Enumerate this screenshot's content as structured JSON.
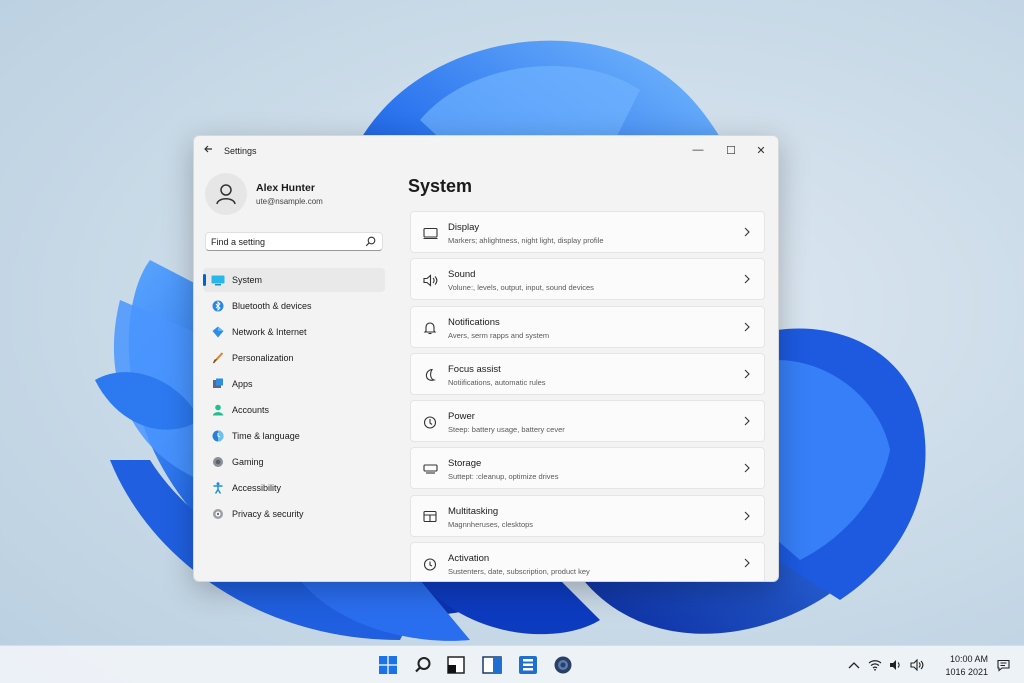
{
  "window": {
    "title": "Settings",
    "back_icon": "arrow-left-icon",
    "controls": {
      "minimize": "—",
      "maximize": "☐",
      "close": "✕"
    }
  },
  "profile": {
    "name": "Alex Hunter",
    "email": "ute@nsample.com",
    "avatar_icon": "user-icon"
  },
  "search": {
    "placeholder": "Find a setting",
    "value": "",
    "icon": "search-icon"
  },
  "sidebar": {
    "items": [
      {
        "label": "System",
        "icon": "system-icon",
        "active": true
      },
      {
        "label": "Bluetooth & devices",
        "icon": "bluetooth-icon"
      },
      {
        "label": "Network & Internet",
        "icon": "network-icon"
      },
      {
        "label": "Personalization",
        "icon": "brush-icon"
      },
      {
        "label": "Apps",
        "icon": "apps-icon"
      },
      {
        "label": "Accounts",
        "icon": "accounts-icon"
      },
      {
        "label": "Time & language",
        "icon": "time-language-icon"
      },
      {
        "label": "Gaming",
        "icon": "gaming-icon"
      },
      {
        "label": "Accessibility",
        "icon": "accessibility-icon"
      },
      {
        "label": "Privacy & security",
        "icon": "shield-icon"
      }
    ]
  },
  "main": {
    "title": "System",
    "cards": [
      {
        "title": "Display",
        "desc": "Markers; ahlightness, night light, display profile",
        "icon": "display-icon"
      },
      {
        "title": "Sound",
        "desc": "Volune:, levels, output, input, sound devices",
        "icon": "speaker-icon"
      },
      {
        "title": "Notifications",
        "desc": "Avers, serm rapps and system",
        "icon": "bell-icon"
      },
      {
        "title": "Focus assist",
        "desc": "Notiifications, automatic rules",
        "icon": "moon-icon"
      },
      {
        "title": "Power",
        "desc": "Steep: battery usage, battery cever",
        "icon": "power-icon"
      },
      {
        "title": "Storage",
        "desc": "Suttept: :cleanup, optimize drives",
        "icon": "storage-icon"
      },
      {
        "title": "Multitasking",
        "desc": "Magnnheruses, clesktops",
        "icon": "multitasking-icon"
      },
      {
        "title": "Activation",
        "desc": "Sustenters, date, subscription, product key",
        "icon": "activation-icon"
      }
    ]
  },
  "taskbar": {
    "apps": [
      "windows-start-icon",
      "search-icon",
      "widgets-icon",
      "task-view-icon",
      "file-explorer-icon",
      "settings-gear-icon"
    ],
    "tray": [
      "chevron-up-icon",
      "wifi-icon",
      "volume-icon",
      "speaker-icon"
    ],
    "time": "10:00 AM",
    "date": "1016 2021",
    "notification_icon": "notification-icon"
  },
  "colors": {
    "accent": "#0067c0",
    "wallpaper_blue": "#1f6fe8"
  }
}
